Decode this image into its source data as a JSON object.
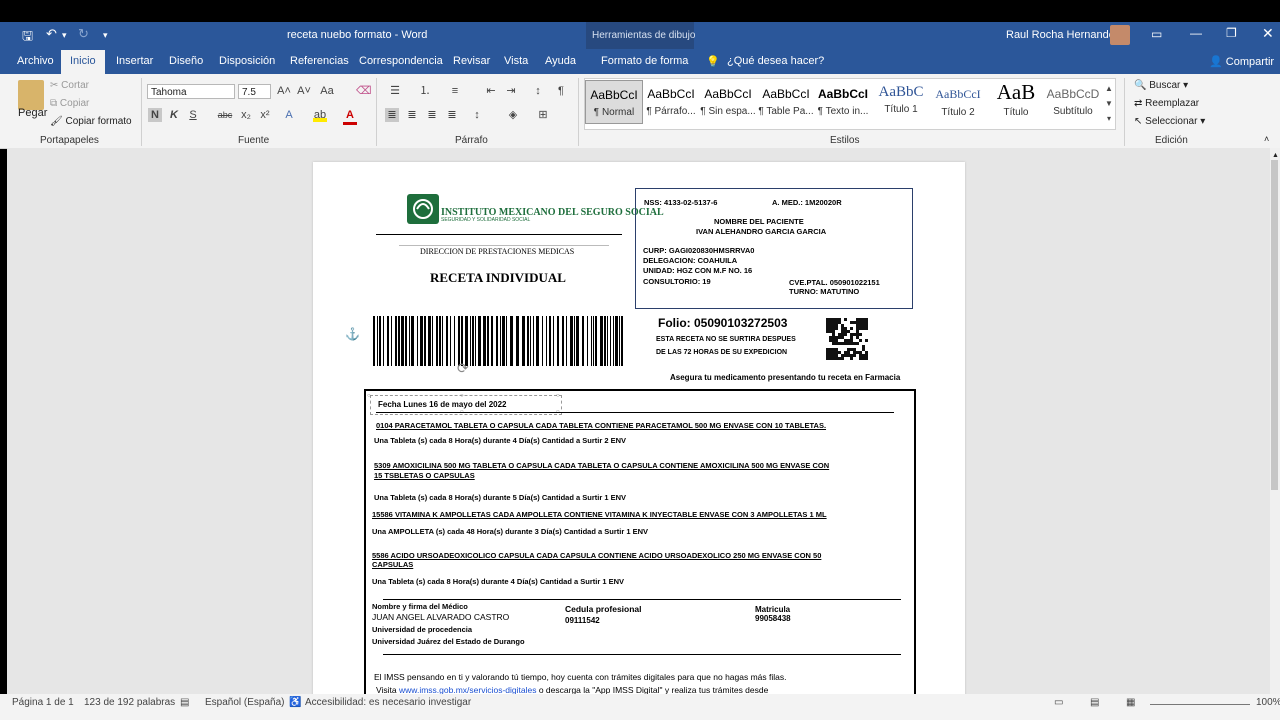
{
  "window": {
    "title": "receta nuebo formato  -  Word",
    "context_title": "Herramientas de dibujo",
    "user": "Raul Rocha Hernandez"
  },
  "tabs": [
    "Archivo",
    "Inicio",
    "Insertar",
    "Diseño",
    "Disposición",
    "Referencias",
    "Correspondencia",
    "Revisar",
    "Vista",
    "Ayuda",
    "Formato de forma"
  ],
  "search_hint": "¿Qué desea hacer?",
  "share": "Compartir",
  "ribbon": {
    "clipboard": {
      "paste": "Pegar",
      "cut": "Cortar",
      "copy": "Copiar",
      "format": "Copiar formato",
      "label": "Portapapeles"
    },
    "font": {
      "name": "Tahoma",
      "size": "7.5",
      "bold": "N",
      "italic": "K",
      "underline": "S",
      "strike": "abc",
      "label": "Fuente"
    },
    "paragraph": {
      "label": "Párrafo"
    },
    "styles": {
      "label": "Estilos",
      "items": [
        {
          "sample": "AaBbCcI",
          "name": "¶ Normal"
        },
        {
          "sample": "AaBbCcI",
          "name": "¶ Párrafo..."
        },
        {
          "sample": "AaBbCcI",
          "name": "¶ Sin espa..."
        },
        {
          "sample": "AaBbCcI",
          "name": "¶ Table Pa..."
        },
        {
          "sample": "AaBbCcI",
          "name": "¶ Texto in..."
        },
        {
          "sample": "AaBbC",
          "name": "Título 1"
        },
        {
          "sample": "AaBbCcI",
          "name": "Título 2"
        },
        {
          "sample": "AaB",
          "name": "Título"
        },
        {
          "sample": "AaBbCcD",
          "name": "Subtítulo"
        }
      ]
    },
    "editing": {
      "find": "Buscar",
      "replace": "Reemplazar",
      "select": "Seleccionar",
      "label": "Edición"
    }
  },
  "doc": {
    "org": "INSTITUTO MEXICANO DEL SEGURO SOCIAL",
    "org_sub": "SEGURIDAD Y SOLIDARIDAD SOCIAL",
    "dept": "DIRECCION DE PRESTACIONES MEDICAS",
    "title": "RECETA INDIVIDUAL",
    "nss": "NSS: 4133-02-5137-6",
    "amed": "A. MED.: 1M20020R",
    "patient_label": "NOMBRE DEL PACIENTE",
    "patient_name": "IVAN ALEHANDRO GARCIA GARCIA",
    "curp": "CURP: GAGI020830HMSRRVA0",
    "delegacion": "DELEGACION: COAHUILA",
    "unidad": "UNIDAD: HGZ CON M.F NO. 16",
    "consultorio": "CONSULTORIO:  19",
    "cveptal": "CVE.PTAL. 050901022151",
    "turno": "TURNO:  MATUTINO",
    "folio": "Folio:  05090103272503",
    "warning1": "ESTA RECETA NO SE SURTIRA DESPUES",
    "warning2": "DE LAS 72 HORAS DE SU EXPEDICION",
    "asegura": "Asegura tu medicamento presentando tu receta en Farmacia",
    "fecha": "Fecha Lunes 16 de mayo del 2022",
    "meds": [
      {
        "desc": "0104  PARACETAMOL   TABLETA    O CAPSULA  CADA  TABLETA   CONTIENE    PARACETAMOL   500  MG  ENVASE   CON  10  TABLETAS.",
        "desc2": "",
        "dose": "Una Tableta (s) cada 8 Hora(s) durante 4 Día(s) Cantidad a Surtir 2 ENV"
      },
      {
        "desc": "5309 AMOXICILINA 500 MG TABLETA O CAPSULA CADA TABLETA O CAPSULA CONTIENE AMOXICILINA 500 MG ENVASE CON",
        "desc2": "15 TSBLETAS O CAPSULAS",
        "dose": "Una Tableta (s) cada 8 Hora(s) durante 5 Día(s) Cantidad a Surtir 1 ENV"
      },
      {
        "desc": "15586 VITAMINA K AMPOLLETAS CADA  AMPOLLETA CONTIENE VITAMINA K INYECTABLE ENVASE CON 3 AMPOLLETAS 1 ML",
        "desc2": "",
        "dose": "Una AMPOLLETA (s) cada 48 Hora(s) durante 3 Día(s) Cantidad a Surtir 1 ENV"
      },
      {
        "desc": "5586 ACIDO URSOADEOXICOLICO CAPSULA CADA  CAPSULA CONTIENE ACIDO URSOADEXOLICO 250 MG ENVASE CON 50",
        "desc2": "CAPSULAS",
        "dose": "Una Tableta (s) cada 8 Hora(s) durante 4 Día(s) Cantidad a Surtir 1 ENV"
      }
    ],
    "doctor_label": "Nombre y firma del Médico",
    "doctor_name": "JUAN ANGEL ALVARADO CASTRO",
    "uni_label": "Universidad de procedencia",
    "uni_name": "Universidad Juárez del Estado de Durango",
    "cedula_label": "Cedula profesional",
    "cedula": "09111542",
    "matricula_label": "Matricula",
    "matricula": "99058438",
    "footer1": "El IMSS pensando en ti y valorando tú tiempo, hoy  cuenta con trámites digitales para que no hagas más filas.",
    "footer2a": "Visita",
    "footer2link": "www.imss.gob.mx/servicios-digitales",
    "footer2b": "o descarga la \"App IMSS Digital\" y realiza tus trámites desde"
  },
  "status": {
    "page": "Página 1 de 1",
    "words": "123 de 192 palabras",
    "lang": "Español (España)",
    "access": "Accesibilidad: es necesario investigar",
    "zoom": "100%"
  },
  "colors": {
    "accent": "#2b579a",
    "link": "#1a4fd1"
  }
}
